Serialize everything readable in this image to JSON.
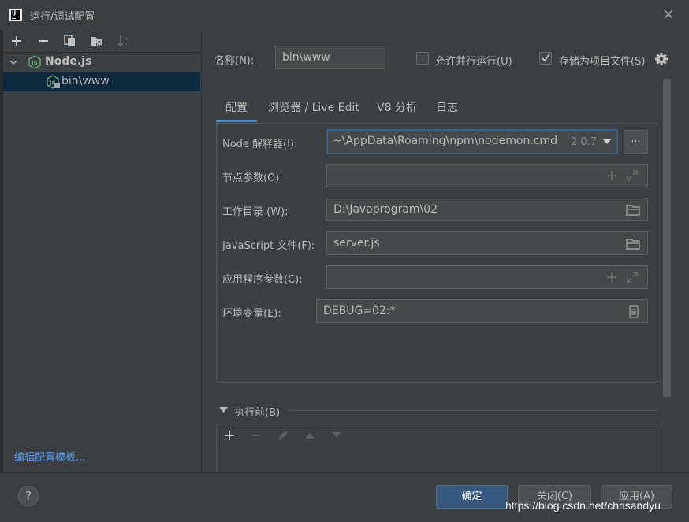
{
  "window": {
    "title": "运行/调试配置"
  },
  "left": {
    "tree": [
      {
        "label": "Node.js",
        "bold": true,
        "expanded": true
      },
      {
        "label": "bin\\www",
        "selected": true
      }
    ],
    "edit_templates_link": "编辑配置模板..."
  },
  "header": {
    "name_label": "名称(N):",
    "name_value": "bin\\www",
    "allow_parallel_label": "允许并行运行(U)",
    "allow_parallel_checked": false,
    "store_as_file_label": "存储为项目文件(S)",
    "store_as_file_checked": true
  },
  "tabs": [
    {
      "label": "配置",
      "active": true
    },
    {
      "label": "浏览器 / Live Edit"
    },
    {
      "label": "V8 分析"
    },
    {
      "label": "日志"
    }
  ],
  "form": {
    "node_interpreter": {
      "label": "Node 解释器(I):",
      "value": "~\\AppData\\Roaming\\npm\\nodemon.cmd",
      "version": "2.0.7",
      "browse_label": "..."
    },
    "node_params": {
      "label": "节点参数(O):",
      "value": ""
    },
    "working_dir": {
      "label": "工作目录 (W):",
      "value": "D:\\Javaprogram\\02"
    },
    "js_file": {
      "label": "JavaScript 文件(F):",
      "value": "server.js"
    },
    "app_params": {
      "label": "应用程序参数(C):",
      "value": ""
    },
    "env_vars": {
      "label": "环境变量(E):",
      "value": "DEBUG=02:*"
    }
  },
  "before_launch": {
    "label": "执行前(B)"
  },
  "buttons": {
    "ok": "确定",
    "cancel": "关闭(C)",
    "apply": "应用(A)",
    "help": "?"
  },
  "watermark": "https://blog.csdn.net/chrisandyu",
  "colors": {
    "background": "#3c3f41",
    "accent": "#4a88c7",
    "selection": "#0d293e",
    "link": "#589df6",
    "nodejs_green": "#6aab73"
  }
}
